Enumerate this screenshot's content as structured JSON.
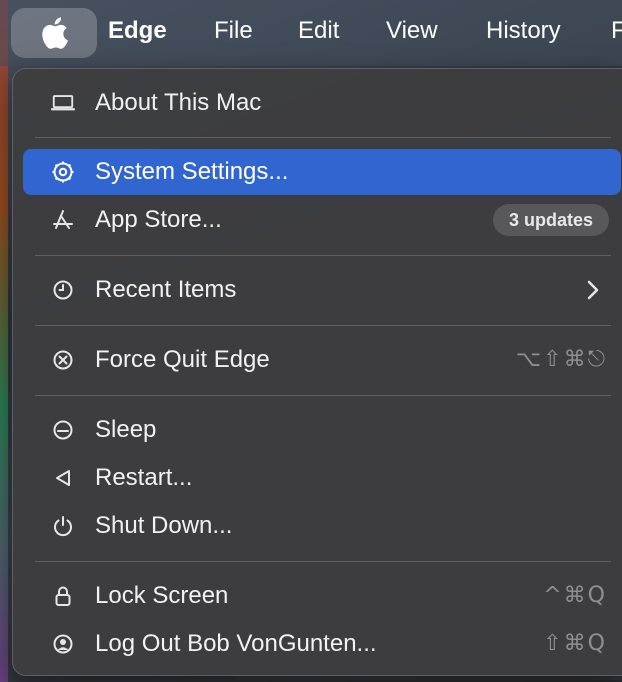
{
  "menubar": {
    "apple_icon": "apple-logo-icon",
    "items": [
      {
        "label": "Edge"
      },
      {
        "label": "File"
      },
      {
        "label": "Edit"
      },
      {
        "label": "View"
      },
      {
        "label": "History"
      },
      {
        "label": "F"
      }
    ]
  },
  "menu": {
    "about": {
      "label": "About This Mac",
      "icon": "laptop-icon"
    },
    "settings": {
      "label": "System Settings...",
      "icon": "gear-icon"
    },
    "appstore": {
      "label": "App Store...",
      "icon": "app-store-icon",
      "badge": "3 updates"
    },
    "recent": {
      "label": "Recent Items",
      "icon": "clock-icon"
    },
    "forcequit": {
      "label": "Force Quit Edge",
      "icon": "force-quit-icon",
      "shortcut": "⌥⇧⌘⎋"
    },
    "sleep": {
      "label": "Sleep",
      "icon": "sleep-icon"
    },
    "restart": {
      "label": "Restart...",
      "icon": "restart-icon"
    },
    "shutdown": {
      "label": "Shut Down...",
      "icon": "power-icon"
    },
    "lock": {
      "label": "Lock Screen",
      "icon": "lock-icon",
      "shortcut": "^⌘Q"
    },
    "logout": {
      "label": "Log Out Bob VonGunten...",
      "icon": "user-icon",
      "shortcut": "⇧⌘Q"
    }
  },
  "colors": {
    "selection": "#3165cf",
    "menu_bg": "#3e3e40"
  }
}
